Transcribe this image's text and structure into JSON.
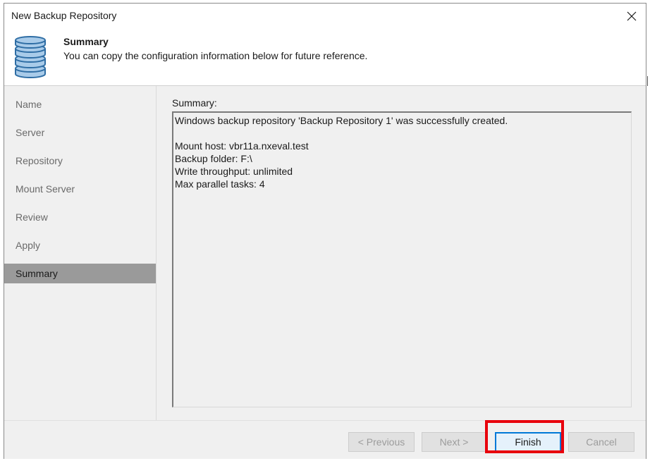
{
  "window": {
    "title": "New Backup Repository"
  },
  "header": {
    "title": "Summary",
    "description": "You can copy the configuration information below for future reference."
  },
  "sidebar": {
    "items": [
      {
        "label": "Name",
        "active": false
      },
      {
        "label": "Server",
        "active": false
      },
      {
        "label": "Repository",
        "active": false
      },
      {
        "label": "Mount Server",
        "active": false
      },
      {
        "label": "Review",
        "active": false
      },
      {
        "label": "Apply",
        "active": false
      },
      {
        "label": "Summary",
        "active": true
      }
    ]
  },
  "main": {
    "summary_label": "Summary:",
    "summary_text": "Windows backup repository 'Backup Repository 1' was successfully created.\n\nMount host: vbr11a.nxeval.test\nBackup folder: F:\\\nWrite throughput: unlimited\nMax parallel tasks: 4"
  },
  "footer": {
    "previous_label": "< Previous",
    "next_label": "Next >",
    "finish_label": "Finish",
    "cancel_label": "Cancel"
  },
  "icons": {
    "header_icon": "database-icon",
    "close_icon": "close-icon"
  },
  "colors": {
    "highlight": "#e8000c",
    "focus_border": "#0078d7",
    "active_nav": "#9a9a9a"
  }
}
